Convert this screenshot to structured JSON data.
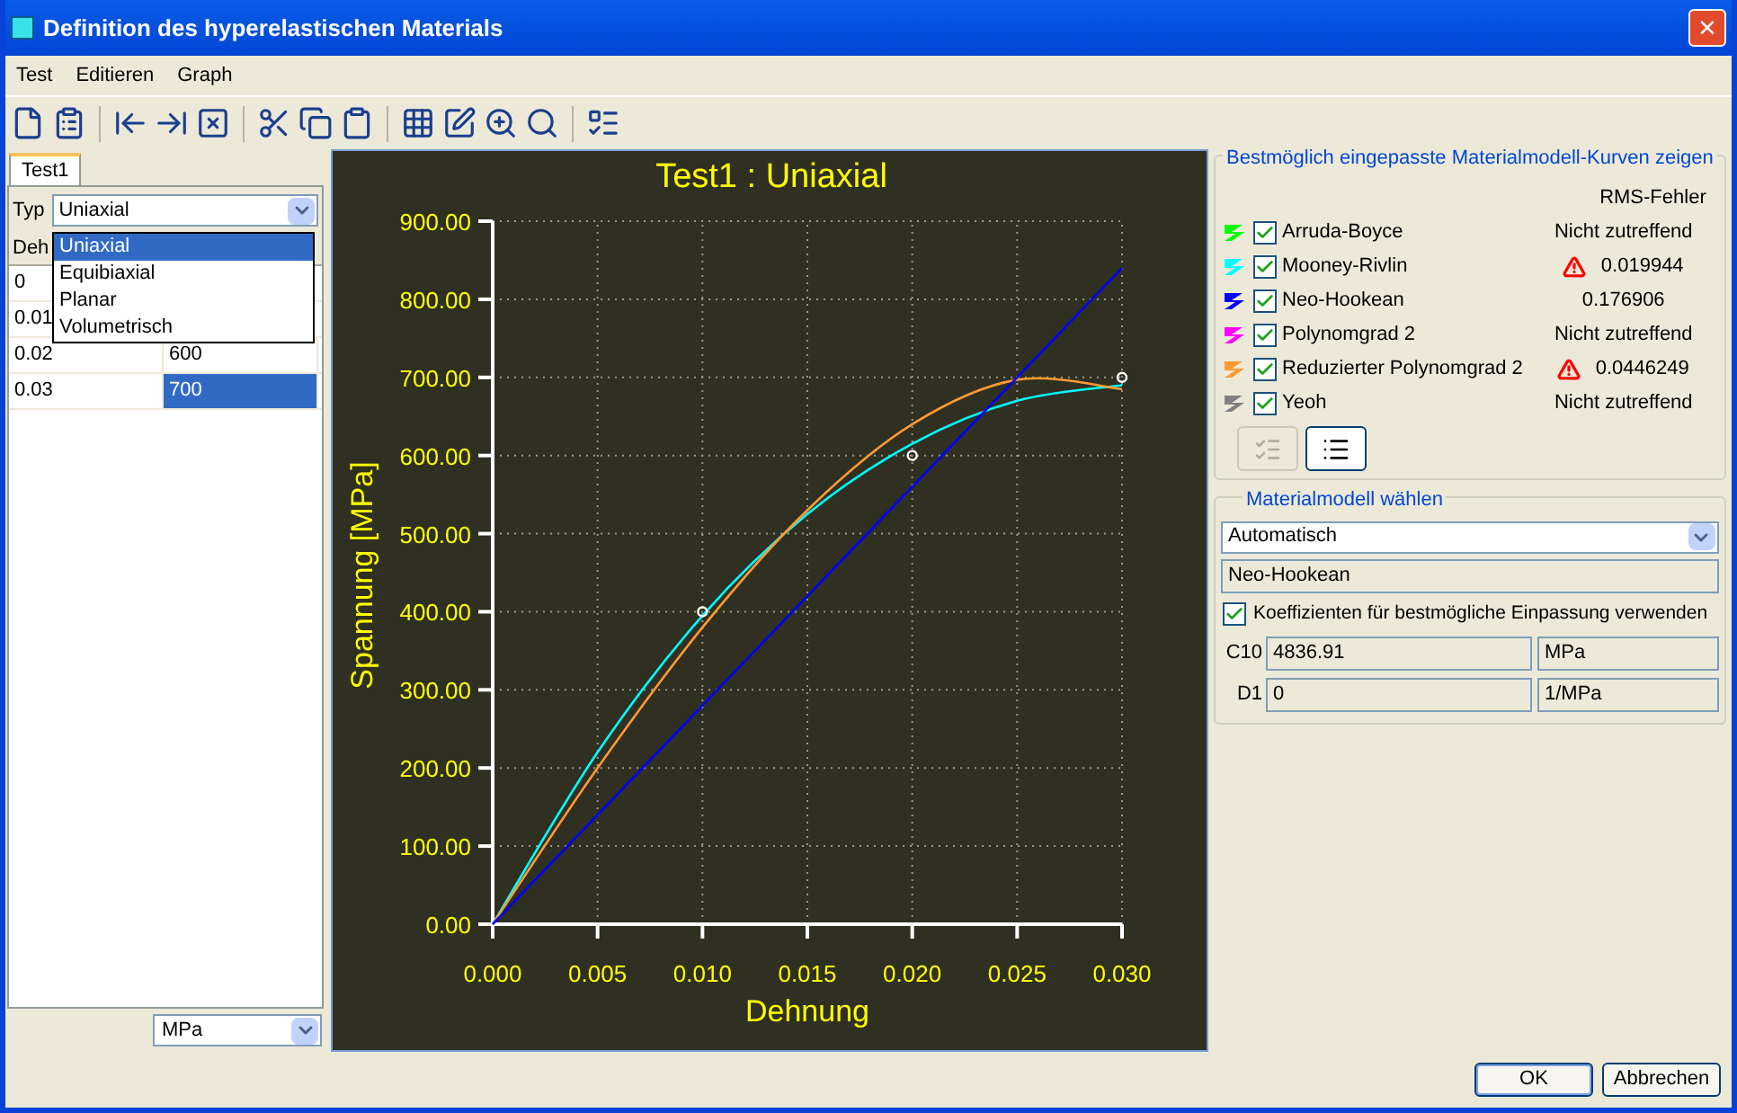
{
  "window": {
    "title": "Definition des hyperelastischen Materials",
    "close": "×"
  },
  "menu": [
    "Test",
    "Editieren",
    "Graph"
  ],
  "left_panel": {
    "tabs": [
      {
        "label": "Test1",
        "selected": true
      }
    ],
    "type_label": "Typ",
    "type_select": {
      "value": "Uniaxial",
      "expanded": true,
      "options": [
        {
          "label": "Uniaxial",
          "selected": true
        },
        {
          "label": "Equibiaxial",
          "selected": false
        },
        {
          "label": "Planar",
          "selected": false
        },
        {
          "label": "Volumetrisch",
          "selected": false
        }
      ]
    },
    "table": {
      "columns": [
        "Deh"
      ],
      "rows": [
        {
          "cells": [
            "0"
          ],
          "selected": false
        },
        {
          "cells": [
            "0.01"
          ],
          "selected": false
        },
        {
          "cells": [
            "0.02",
            "600"
          ],
          "selected": false
        },
        {
          "cells": [
            "0.03",
            "700"
          ],
          "selected": true
        }
      ]
    },
    "unit_select": "MPa"
  },
  "chart": {
    "chart_data": {
      "type": "line",
      "title": "Test1 : Uniaxial",
      "xlabel": "Dehnung",
      "ylabel": "Spannung [MPa]",
      "x": [
        0,
        0.005,
        0.01,
        0.015,
        0.02,
        0.025,
        0.03
      ],
      "series": [
        {
          "type": "line",
          "color": "#00ffff",
          "values": [
            0,
            220,
            395,
            525,
            615,
            670,
            690
          ]
        },
        {
          "type": "line",
          "color": "#ff9933",
          "values": [
            0,
            200,
            380,
            530,
            640,
            697,
            685
          ]
        },
        {
          "type": "line",
          "color": "#0000ff",
          "values": [
            0,
            140,
            280,
            420,
            560,
            700,
            840
          ]
        },
        {
          "type": "scatter",
          "color": "#ffffff",
          "values": [
            null,
            null,
            400,
            null,
            600,
            null,
            700
          ]
        }
      ],
      "xlim": [
        0,
        0.03
      ],
      "ylim": [
        0,
        900
      ],
      "grid": true,
      "xticks": [
        {
          "value": 0,
          "label": "0.000"
        },
        {
          "value": 0.005,
          "label": "0.005"
        },
        {
          "value": 0.01,
          "label": "0.010"
        },
        {
          "value": 0.015,
          "label": "0.015"
        },
        {
          "value": 0.02,
          "label": "0.020"
        },
        {
          "value": 0.025,
          "label": "0.025"
        },
        {
          "value": 0.03,
          "label": "0.030"
        }
      ],
      "yticks": [
        {
          "value": 0,
          "label": "0.00"
        },
        {
          "value": 100,
          "label": "100.00"
        },
        {
          "value": 200,
          "label": "200.00"
        },
        {
          "value": 300,
          "label": "300.00"
        },
        {
          "value": 400,
          "label": "400.00"
        },
        {
          "value": 500,
          "label": "500.00"
        },
        {
          "value": 600,
          "label": "600.00"
        },
        {
          "value": 700,
          "label": "700.00"
        },
        {
          "value": 800,
          "label": "800.00"
        },
        {
          "value": 900,
          "label": "900.00"
        }
      ]
    }
  },
  "fit_group": {
    "title": "Bestmöglich eingepasste Materialmodell-Kurven zeigen",
    "rms_header": "RMS-Fehler",
    "models": [
      {
        "name": "Arruda-Boyce",
        "color": "#00ff00",
        "checked": true,
        "rms": "Nicht zutreffend",
        "warning": false
      },
      {
        "name": "Mooney-Rivlin",
        "color": "#00ffff",
        "checked": true,
        "rms": "0.019944",
        "warning": true
      },
      {
        "name": "Neo-Hookean",
        "color": "#0000ff",
        "checked": true,
        "rms": "0.176906",
        "warning": false
      },
      {
        "name": "Polynomgrad 2",
        "color": "#ff00ff",
        "checked": true,
        "rms": "Nicht zutreffend",
        "warning": false
      },
      {
        "name": "Reduzierter Polynomgrad 2",
        "color": "#ff9933",
        "checked": true,
        "rms": "0.0446249",
        "warning": true
      },
      {
        "name": "Yeoh",
        "color": "#808080",
        "checked": true,
        "rms": "Nicht zutreffend",
        "warning": false
      }
    ]
  },
  "model_group": {
    "title": "Materialmodell wählen",
    "select": "Automatisch",
    "model": "Neo-Hookean",
    "use_best_fit": {
      "label": "Koeffizienten für bestmögliche Einpassung verwenden",
      "checked": true
    },
    "coefficients": [
      {
        "label": "C10",
        "value": "4836.91",
        "unit": "MPa"
      },
      {
        "label": "D1",
        "value": "0",
        "unit": "1/MPa"
      }
    ]
  },
  "buttons": [
    "OK",
    "Abbrechen"
  ]
}
